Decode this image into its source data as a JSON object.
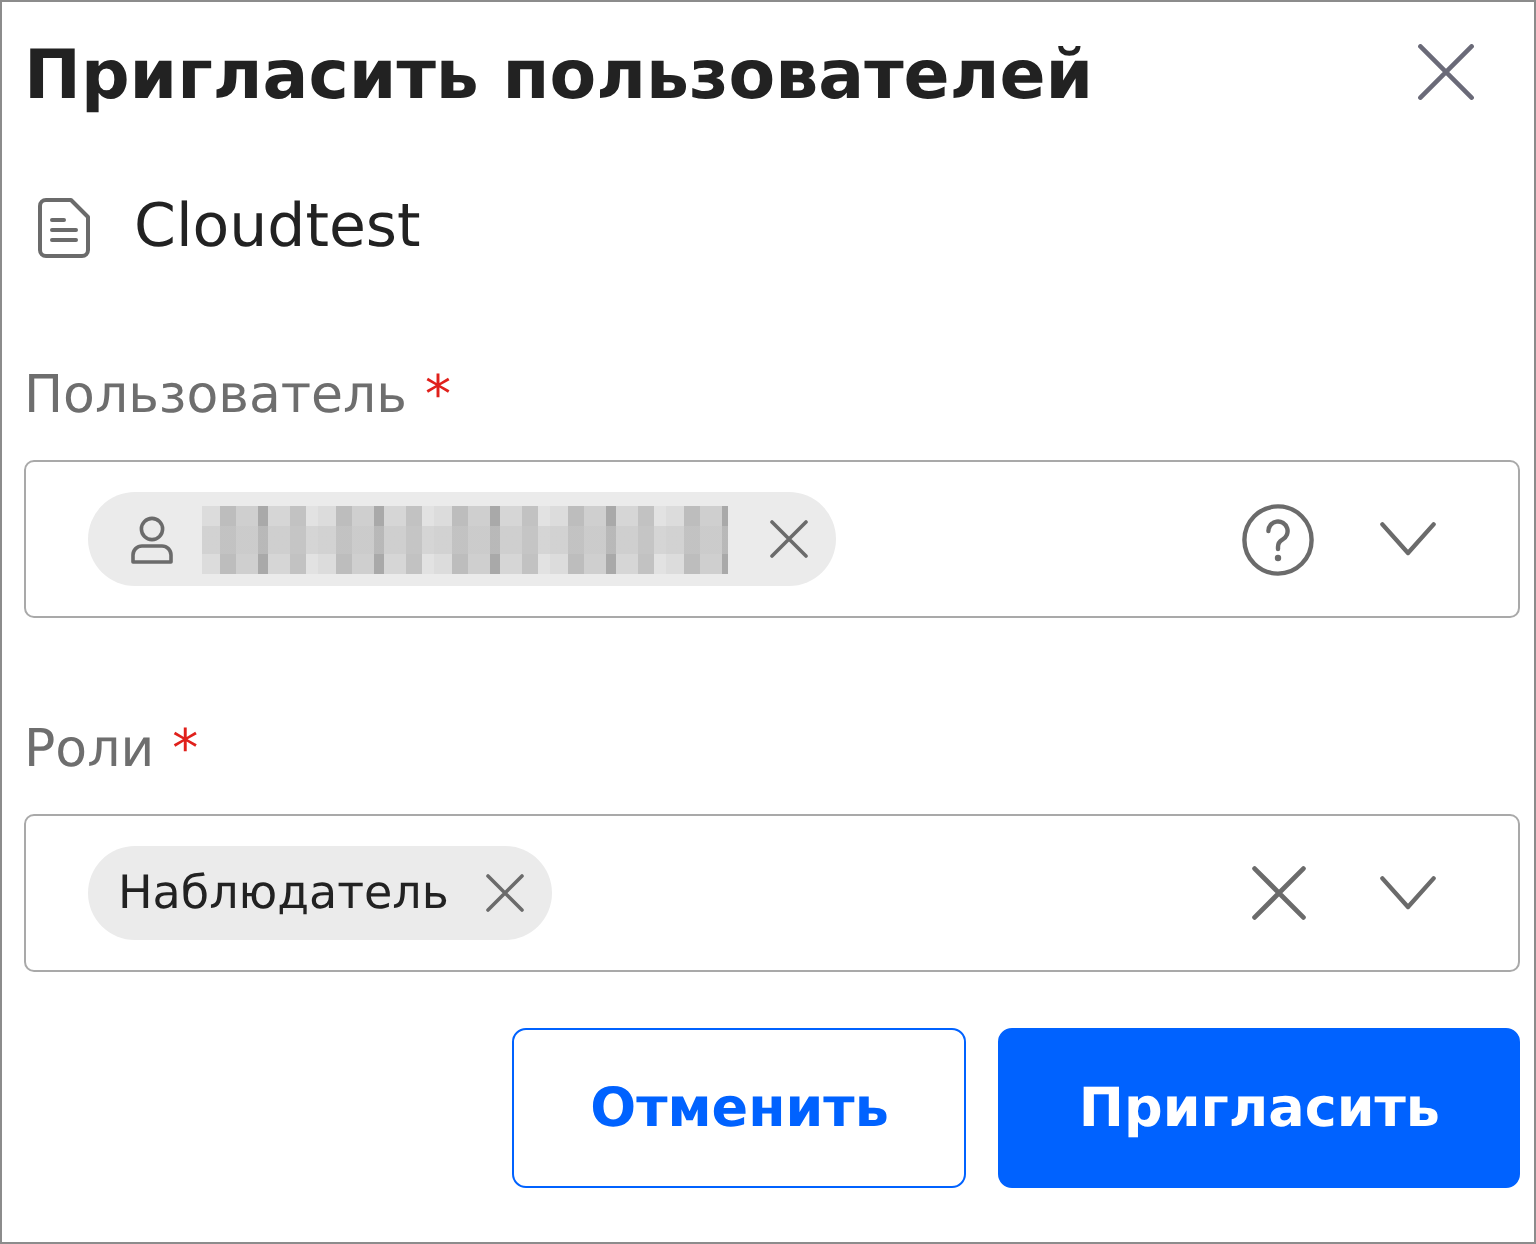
{
  "dialog": {
    "title": "Пригласить пользователей"
  },
  "resource": {
    "name": "Cloudtest"
  },
  "fields": [
    {
      "kind": "user",
      "label": "Пользователь",
      "required_mark": "*",
      "chips": [
        {
          "kind": "person"
        }
      ]
    },
    {
      "kind": "roles",
      "label": "Роли",
      "required_mark": "*",
      "chips": [
        {
          "kind": "role",
          "label": "Наблюдатель"
        }
      ]
    }
  ],
  "buttons": [
    {
      "kind": "secondary",
      "label": "Отменить"
    },
    {
      "kind": "primary",
      "label": "Пригласить"
    }
  ]
}
